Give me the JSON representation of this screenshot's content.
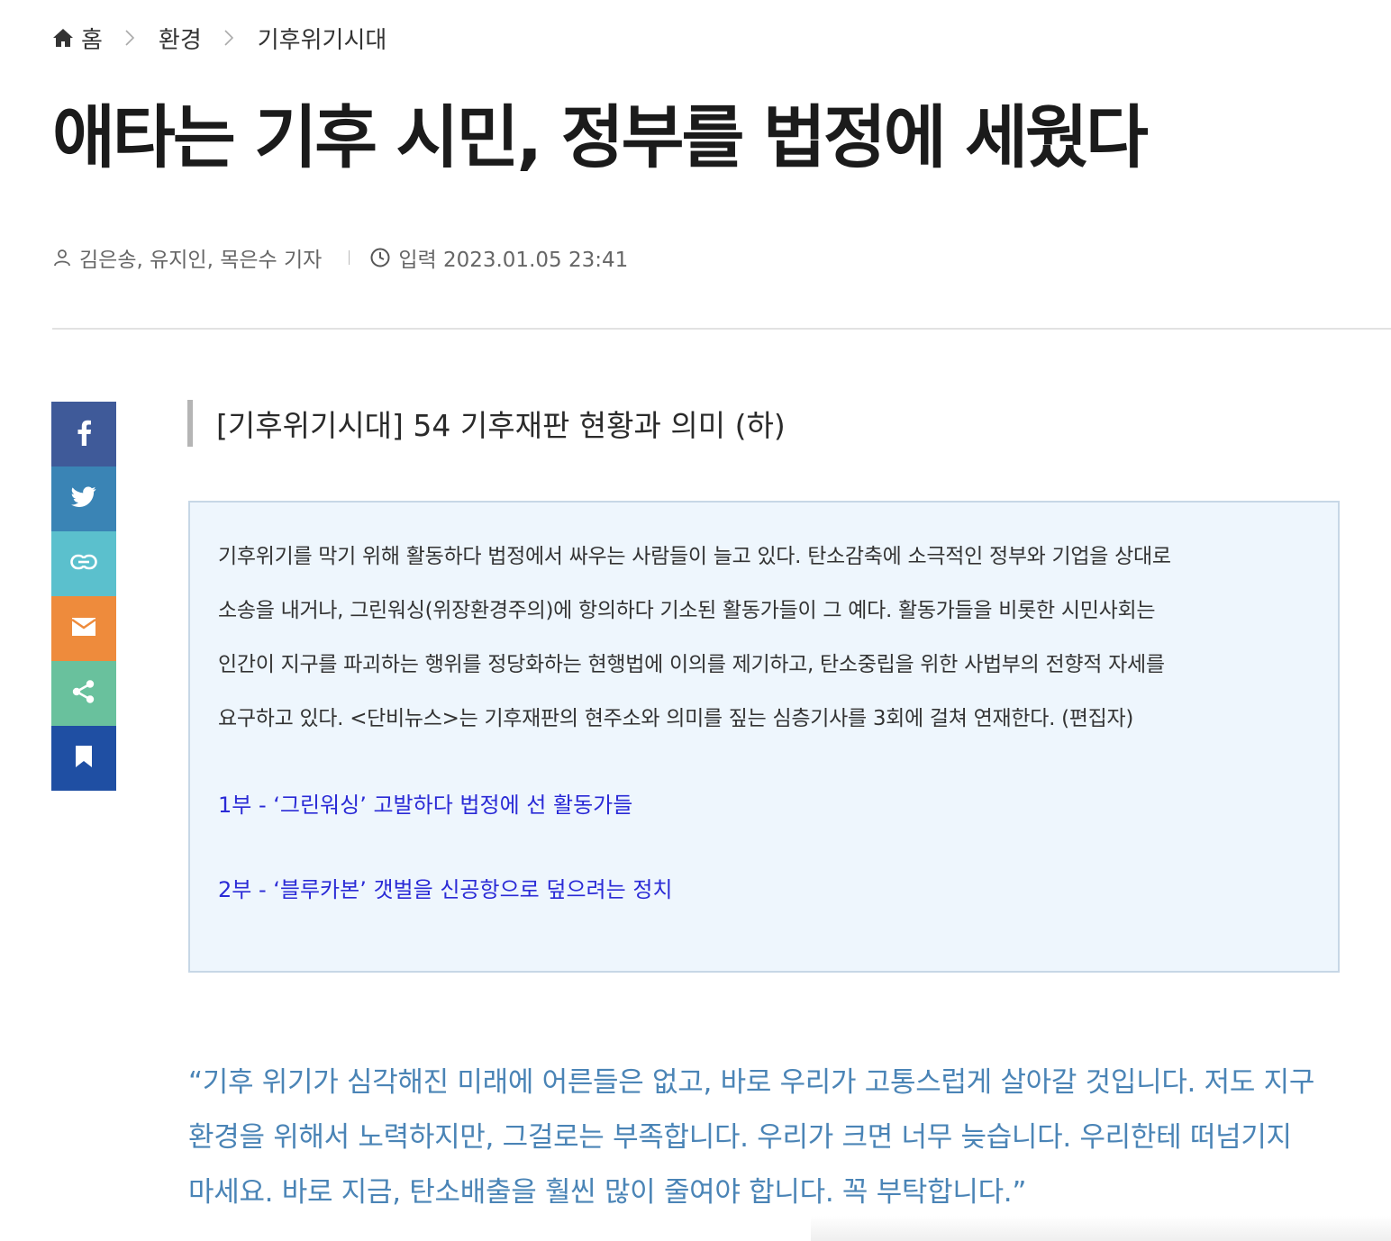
{
  "breadcrumb": {
    "home": "홈",
    "section": "환경",
    "subsection": "기후위기시대"
  },
  "article": {
    "title": "애타는 기후 시민, 정부를 법정에 세웠다",
    "byline": "김은송, 유지인, 목은수 기자",
    "published": "입력 2023.01.05 23:41",
    "subtitle": "[기후위기시대] 54 기후재판 현황과 의미 (하)"
  },
  "share": {
    "items": [
      {
        "name": "facebook",
        "color": "#3b5998"
      },
      {
        "name": "twitter",
        "color": "#3a84b5"
      },
      {
        "name": "link",
        "color": "#5bc0cd"
      },
      {
        "name": "email",
        "color": "#ee8b3c"
      },
      {
        "name": "share",
        "color": "#69c19d"
      },
      {
        "name": "bookmark",
        "color": "#1f4fa3"
      }
    ]
  },
  "summary": {
    "lines": [
      "기후위기를 막기 위해 활동하다 법정에서 싸우는 사람들이 늘고 있다. 탄소감축에 소극적인 정부와 기업을 상대로",
      "소송을 내거나, 그린워싱(위장환경주의)에 항의하다 기소된 활동가들이 그 예다. 활동가들을 비롯한 시민사회는",
      "인간이 지구를 파괴하는 행위를 정당화하는 현행법에 이의를 제기하고, 탄소중립을 위한 사법부의 전향적 자세를",
      "요구하고 있다. <단비뉴스>는 기후재판의 현주소와 의미를 짚는 심층기사를 3회에 걸쳐 연재한다. (편집자)"
    ],
    "links": [
      "1부 - ‘그린워싱’ 고발하다 법정에 선 활동가들",
      "2부 - ‘블루카본’ 갯벌을 신공항으로 덮으려는 정치"
    ]
  },
  "quote": {
    "lines": [
      "“기후 위기가 심각해진 미래에 어른들은 없고, 바로 우리가 고통스럽게 살아갈 것입니다. 저도 지구",
      "환경을 위해서 노력하지만, 그걸로는 부족합니다. 우리가 크면 너무 늦습니다. 우리한테 떠넘기지",
      "마세요. 바로 지금, 탄소배출을 훨씬 많이 줄여야 합니다. 꼭 부탁합니다.”"
    ]
  }
}
